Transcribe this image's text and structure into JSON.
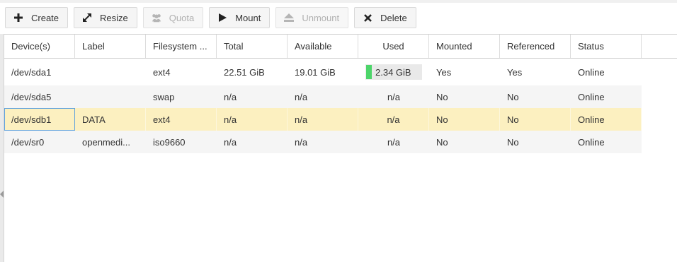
{
  "toolbar": {
    "buttons": [
      {
        "label": "Create",
        "icon": "plus-icon",
        "enabled": true
      },
      {
        "label": "Resize",
        "icon": "resize-arrows-icon",
        "enabled": true
      },
      {
        "label": "Quota",
        "icon": "users-icon",
        "enabled": false
      },
      {
        "label": "Mount",
        "icon": "play-icon",
        "enabled": true
      },
      {
        "label": "Unmount",
        "icon": "eject-icon",
        "enabled": false
      },
      {
        "label": "Delete",
        "icon": "close-icon",
        "enabled": true
      }
    ]
  },
  "grid": {
    "columns": [
      "Device(s)",
      "Label",
      "Filesystem ...",
      "Total",
      "Available",
      "Used",
      "Mounted",
      "Referenced",
      "Status"
    ],
    "rows": [
      {
        "device": "/dev/sda1",
        "label": "",
        "filesystem": "ext4",
        "total": "22.51 GiB",
        "available": "19.01 GiB",
        "used": "2.34 GiB",
        "used_fraction": 0.1,
        "mounted": "Yes",
        "referenced": "Yes",
        "status": "Online"
      },
      {
        "device": "/dev/sda5",
        "label": "",
        "filesystem": "swap",
        "total": "n/a",
        "available": "n/a",
        "used": "n/a",
        "mounted": "No",
        "referenced": "No",
        "status": "Online"
      },
      {
        "device": "/dev/sdb1",
        "label": "DATA",
        "filesystem": "ext4",
        "total": "n/a",
        "available": "n/a",
        "used": "n/a",
        "mounted": "No",
        "referenced": "No",
        "status": "Online"
      },
      {
        "device": "/dev/sr0",
        "label": "openmedi...",
        "filesystem": "iso9660",
        "total": "n/a",
        "available": "n/a",
        "used": "n/a",
        "mounted": "No",
        "referenced": "No",
        "status": "Online"
      }
    ],
    "selected_row": 2
  },
  "colors": {
    "used_bar": "#4dd56a",
    "selected_row": "#fcf0c0",
    "focus_outline": "#5fa2dd"
  }
}
